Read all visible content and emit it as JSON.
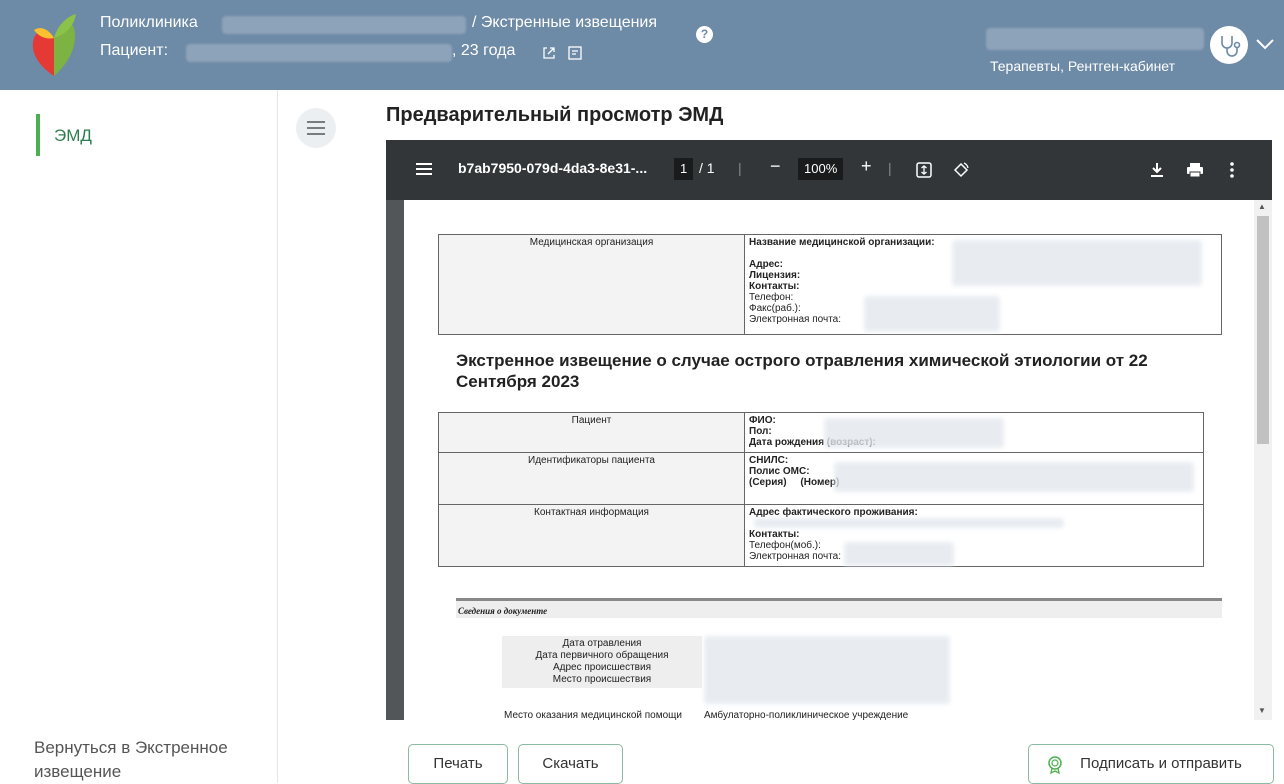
{
  "header": {
    "clinic_label": "Поликлиника",
    "breadcrumb": "/ Экстренные извещения",
    "patient_label": "Пациент:",
    "patient_age": ", 23 года",
    "department": "Терапевты, Рентген-кабинет"
  },
  "sidebar": {
    "items": [
      {
        "label": "ЭМД",
        "active": true
      }
    ],
    "back_link": "Вернуться в Экстренное извещение"
  },
  "main": {
    "title": "Предварительный просмотр ЭМД"
  },
  "viewer": {
    "file_name": "b7ab7950-079d-4da3-8e31-...",
    "page_current": "1",
    "page_total": "/ 1",
    "zoom": "100%"
  },
  "document": {
    "org_label": "Медицинская организация",
    "org_fields": [
      "Название медицинской организации:",
      "Адрес:",
      "Лицензия:",
      "Контакты:",
      "Телефон:",
      "Факс(раб.):",
      "Электронная почта:"
    ],
    "title": "Экстренное извещение о случае острого отравления химической этиологии от 22 Сентября 2023",
    "patient_label": "Пациент",
    "patient_fields": [
      "ФИО:",
      "Пол:",
      "Дата рождения (возраст):"
    ],
    "ids_label": "Идентификаторы пациента",
    "ids_fields": [
      "СНИЛС:",
      "Полис ОМС:",
      "(Серия)     (Номер)"
    ],
    "contact_label": "Контактная информация",
    "contact_fields": [
      "Адрес фактического проживания:",
      "Контакты:",
      "Телефон(моб.):",
      "Электронная почта:"
    ],
    "section_title": "Сведения о документе",
    "info_labels": [
      "Дата отравления",
      "Дата первичного обращения",
      "Адрес происшествия",
      "Место происшествия"
    ],
    "care_place_label": "Место оказания медицинской помощи",
    "care_place_value": "Амбулаторно-поликлиническое учреждение"
  },
  "buttons": {
    "print": "Печать",
    "download": "Скачать",
    "sign_send": "Подписать и отправить"
  },
  "colors": {
    "header_bg": "#6d8aa6",
    "accent_green": "#4caf50",
    "viewer_toolbar": "#323639"
  }
}
